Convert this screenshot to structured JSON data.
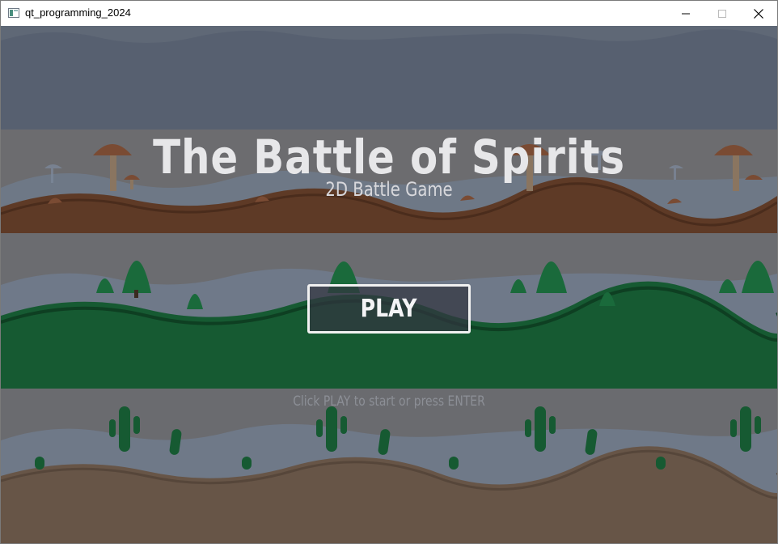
{
  "window": {
    "title": "qt_programming_2024",
    "app_icon": "qt-window-icon",
    "controls": [
      "minimize-icon",
      "maximize-icon",
      "close-icon"
    ]
  },
  "game": {
    "title": "The Battle of Spirits",
    "subtitle": "2D Battle Game",
    "play_button": "PLAY",
    "hint": "Click PLAY to start or press ENTER"
  },
  "colors": {
    "sky": "#565f6b",
    "mushroom_band": "#6b6b6e",
    "forest_band": "#6a6b6e",
    "desert_band": "#6a6b6e",
    "dirt": "#5e3a26",
    "grass": "#165a32",
    "sand": "#66554a",
    "title_text": "#e7e7e9"
  }
}
